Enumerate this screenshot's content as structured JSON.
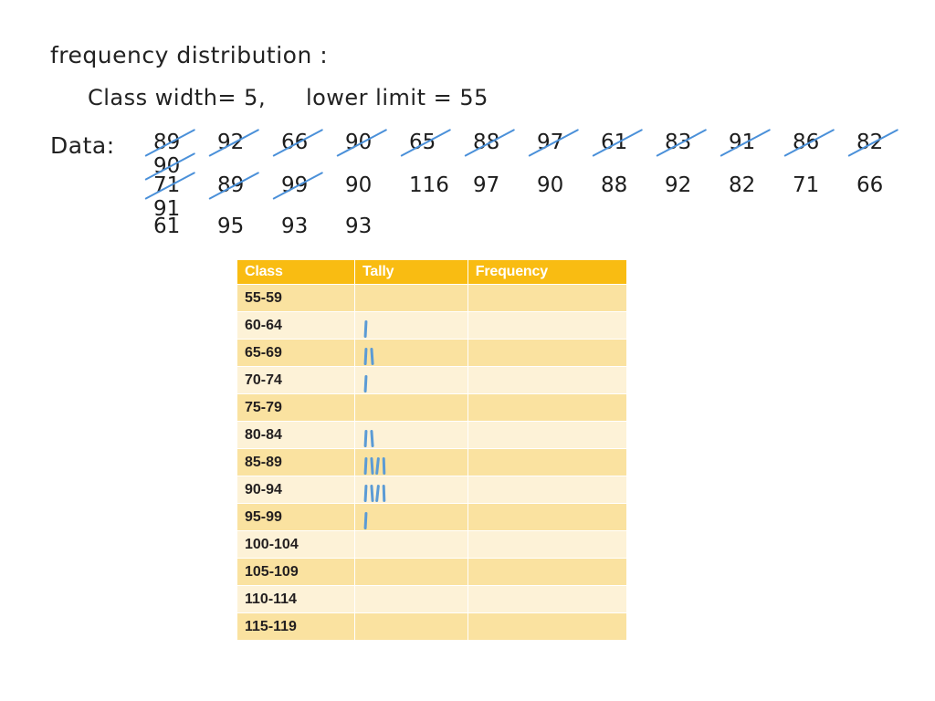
{
  "notes": {
    "title": "frequency distribution :",
    "class_width_label": "Class width= 5",
    "lower_limit_label": "lower limit = 55",
    "params_separator": ",",
    "data_label": "Data:",
    "data_rows": [
      [
        {
          "value": "89",
          "struck": true
        },
        {
          "value": "92",
          "struck": true
        },
        {
          "value": "66",
          "struck": true
        },
        {
          "value": "90",
          "struck": true
        },
        {
          "value": "65",
          "struck": true
        },
        {
          "value": "88",
          "struck": true
        },
        {
          "value": "97",
          "struck": true
        },
        {
          "value": "61",
          "struck": true
        },
        {
          "value": "83",
          "struck": true
        },
        {
          "value": "91",
          "struck": true
        },
        {
          "value": "86",
          "struck": true
        },
        {
          "value": "82",
          "struck": true
        },
        {
          "value": "90",
          "struck": true
        }
      ],
      [
        {
          "value": "71",
          "struck": true
        },
        {
          "value": "89",
          "struck": true
        },
        {
          "value": "99",
          "struck": true
        },
        {
          "value": "90",
          "struck": false
        },
        {
          "value": "116",
          "struck": false
        },
        {
          "value": "97",
          "struck": false
        },
        {
          "value": "90",
          "struck": false
        },
        {
          "value": "88",
          "struck": false
        },
        {
          "value": "92",
          "struck": false
        },
        {
          "value": "82",
          "struck": false
        },
        {
          "value": "71",
          "struck": false
        },
        {
          "value": "66",
          "struck": false
        },
        {
          "value": "91",
          "struck": false
        }
      ],
      [
        {
          "value": "61",
          "struck": false
        },
        {
          "value": "95",
          "struck": false
        },
        {
          "value": "93",
          "struck": false
        },
        {
          "value": "93",
          "struck": false
        }
      ]
    ]
  },
  "table": {
    "headers": [
      "Class",
      "Tally",
      "Frequency"
    ],
    "rows": [
      {
        "class": "55-59",
        "tally": 0,
        "frequency": ""
      },
      {
        "class": "60-64",
        "tally": 1,
        "frequency": ""
      },
      {
        "class": "65-69",
        "tally": 2,
        "frequency": ""
      },
      {
        "class": "70-74",
        "tally": 1,
        "frequency": ""
      },
      {
        "class": "75-79",
        "tally": 0,
        "frequency": ""
      },
      {
        "class": "80-84",
        "tally": 2,
        "frequency": ""
      },
      {
        "class": "85-89",
        "tally": 4,
        "frequency": ""
      },
      {
        "class": "90-94",
        "tally": 4,
        "frequency": ""
      },
      {
        "class": "95-99",
        "tally": 1,
        "frequency": ""
      },
      {
        "class": "100-104",
        "tally": 0,
        "frequency": ""
      },
      {
        "class": "105-109",
        "tally": 0,
        "frequency": ""
      },
      {
        "class": "110-114",
        "tally": 0,
        "frequency": ""
      },
      {
        "class": "115-119",
        "tally": 0,
        "frequency": ""
      }
    ]
  },
  "colors": {
    "header_bg": "#f9bc12",
    "header_text": "#ffffff",
    "row_dark": "#fae2a0",
    "row_light": "#fdf2d7",
    "tally_blue": "#5b9bd5",
    "strike_blue": "#4a90d9",
    "ink": "#231f20",
    "page_bg": "#ffffff"
  }
}
